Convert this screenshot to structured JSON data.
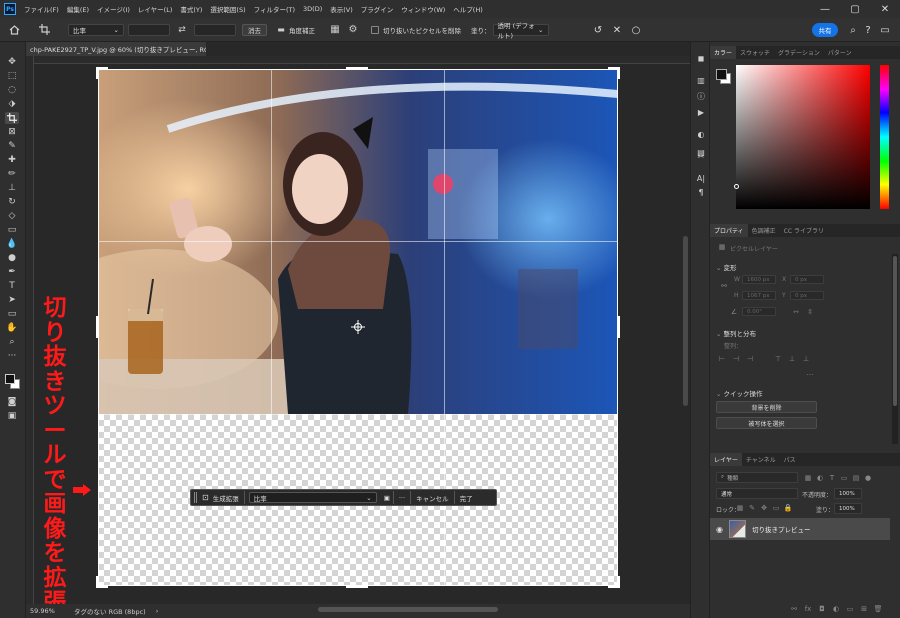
{
  "app": {
    "logo": "Ps",
    "menus": [
      "ファイル(F)",
      "編集(E)",
      "イメージ(I)",
      "レイヤー(L)",
      "書式(Y)",
      "選択範囲(S)",
      "フィルター(T)",
      "3D(D)",
      "表示(V)",
      "プラグイン",
      "ウィンドウ(W)",
      "ヘルプ(H)"
    ],
    "window_controls": [
      "—",
      "▢",
      "✕"
    ]
  },
  "options": {
    "ratio_select": "比率",
    "clear_button": "消去",
    "straighten_label": "角度補正",
    "delete_cropped_label": "切り抜いたピクセルを削除",
    "fill_label": "塗り：",
    "fill_select": "透明 (デフォルト)",
    "share_button": "共有"
  },
  "document": {
    "tab_title": "chp-PAKE2927_TP_V.jpg @ 60% (切り抜きプレビュー, RGB/8#) *",
    "zoom": "59.96%",
    "profile": "タグのない RGB (8bpc)"
  },
  "context_bar": {
    "generative_expand": "生成拡張",
    "ratio_select": "比率",
    "more": "···",
    "cancel": "キャンセル",
    "done": "完了"
  },
  "annotation": {
    "text": [
      "切",
      "り",
      "抜",
      "き",
      "ツ",
      "ー",
      "ル",
      "で",
      "画",
      "像",
      "を",
      "拡",
      "張"
    ],
    "arrow": "➡",
    "color": "#ff1a1a"
  },
  "panels": {
    "color_tabs": [
      "カラー",
      "スウォッチ",
      "グラデーション",
      "パターン"
    ],
    "properties_tabs": [
      "プロパティ",
      "色調補正",
      "CC ライブラリ"
    ],
    "properties": {
      "layer_type": "ピクセルレイヤー",
      "transform_header": "変形",
      "w_label": "W",
      "w_value": "1600 px",
      "h_label": "H",
      "h_value": "1067 px",
      "x_label": "X",
      "x_value": "0 px",
      "y_label": "Y",
      "y_value": "0 px",
      "angle_value": "0.00°",
      "align_header": "整列と分布",
      "align_label": "整列：",
      "quick_actions_header": "クイック操作",
      "remove_bg_button": "背景を削除",
      "select_subject_button": "被写体を選択"
    },
    "layers_tabs": [
      "レイヤー",
      "チャンネル",
      "パス"
    ],
    "layers": {
      "search_placeholder": "種類",
      "blend_mode": "通常",
      "opacity_label": "不透明度：",
      "opacity_value": "100%",
      "lock_label": "ロック：",
      "fill_label": "塗り：",
      "fill_value": "100%",
      "layer_name": "切り抜きプレビュー"
    }
  },
  "colors": {
    "accent": "#1473e6",
    "panel_bg": "#2f2f2f",
    "canvas_bg": "#282828"
  }
}
